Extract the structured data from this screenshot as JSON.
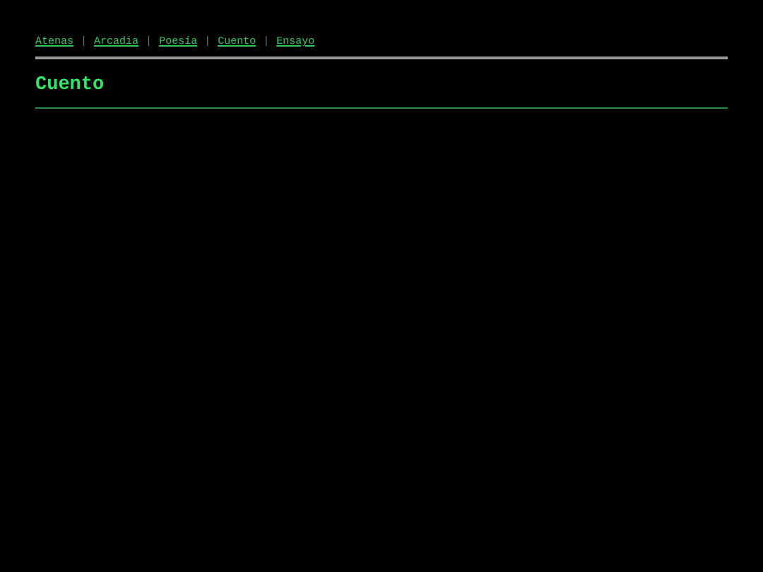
{
  "breadcrumbs": [
    {
      "label": "Atenas"
    },
    {
      "label": "Arcadia"
    },
    {
      "label": "Poesía"
    },
    {
      "label": "Cuento"
    },
    {
      "label": "Ensayo"
    }
  ],
  "separator": "|",
  "heading": "Cuento"
}
